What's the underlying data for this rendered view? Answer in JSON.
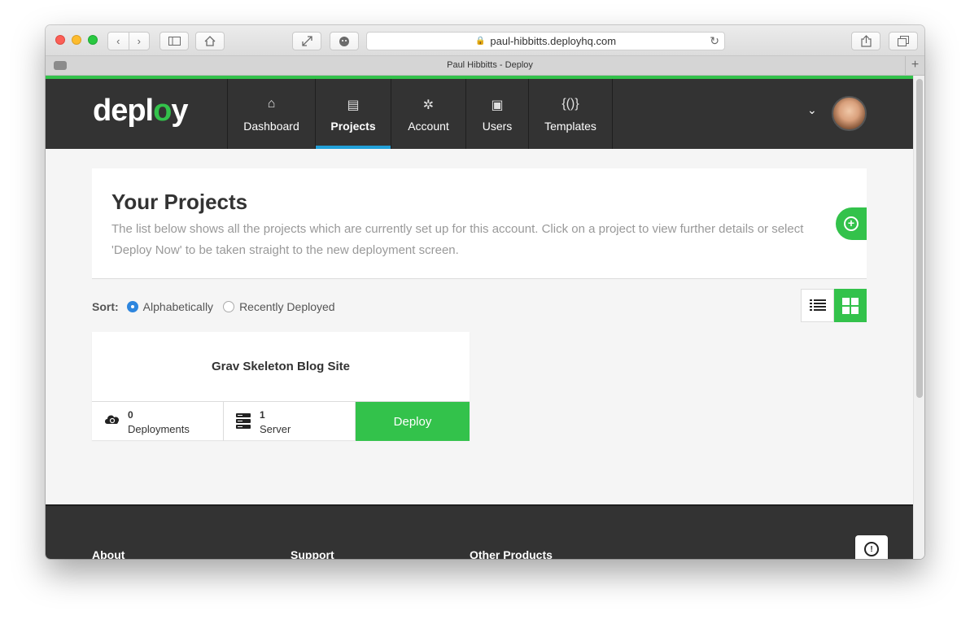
{
  "browser": {
    "url": "paul-hibbitts.deployhq.com",
    "tab_title": "Paul Hibbitts - Deploy",
    "back_icon": "‹",
    "forward_icon": "›",
    "reload_icon": "↻"
  },
  "brand": {
    "logo_prefix": "depl",
    "logo_mid": "o",
    "logo_suffix": "y"
  },
  "nav": {
    "items": [
      {
        "label": "Dashboard",
        "icon": "⌂"
      },
      {
        "label": "Projects",
        "icon": "▤"
      },
      {
        "label": "Account",
        "icon": "✲"
      },
      {
        "label": "Users",
        "icon": "▣"
      },
      {
        "label": "Templates",
        "icon": "{()}"
      }
    ],
    "chevron": "⌄"
  },
  "intro": {
    "title": "Your Projects",
    "description": "The list below shows all the projects which are currently set up for this account. Click on a project to view further details or select 'Deploy Now' to be taken straight to the new deployment screen."
  },
  "sort": {
    "label": "Sort:",
    "options": [
      "Alphabetically",
      "Recently Deployed"
    ],
    "selected": "Alphabetically"
  },
  "projects": [
    {
      "name": "Grav Skeleton Blog Site",
      "deployments_count": "0",
      "deployments_label": "Deployments",
      "servers_count": "1",
      "servers_label": "Server",
      "deploy_label": "Deploy"
    }
  ],
  "footer": {
    "headings": [
      "About",
      "Support",
      "Other Products"
    ]
  },
  "colors": {
    "accent": "#33c24b",
    "nav_bg": "#333333",
    "active_tab": "#21a0d8"
  }
}
